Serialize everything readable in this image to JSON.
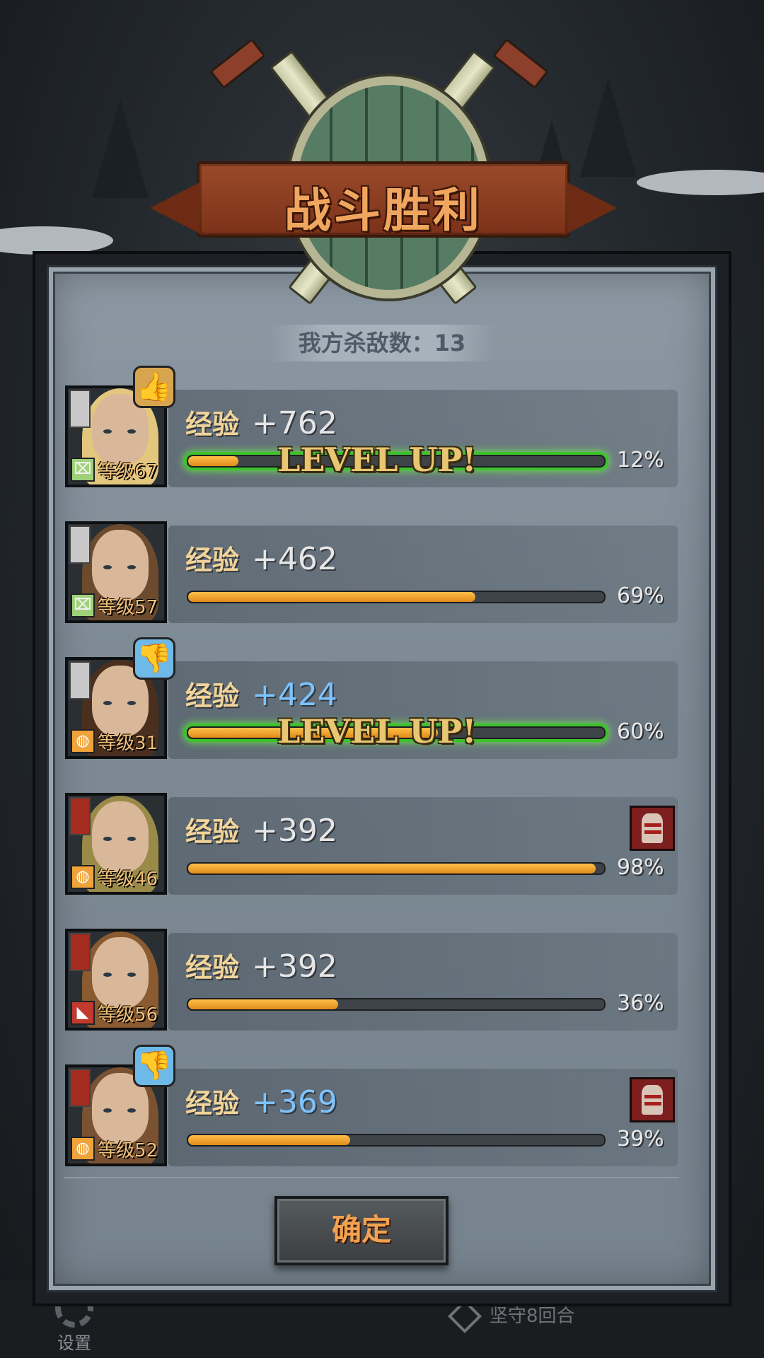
{
  "title": "战斗胜利",
  "kills_label": "我方杀敌数：13",
  "level_up_text": "LEVEL UP!",
  "exp_label": "经验",
  "confirm_label": "确定",
  "bottom": {
    "settings_label": "设置",
    "defend_label": "坚守8回合"
  },
  "heroes": [
    {
      "exp": "+762",
      "exp_highlight": false,
      "level": "等级67",
      "progress": "12%",
      "progress_value": 12,
      "level_up": true,
      "badge": "thumbs-up",
      "injured": false,
      "class": "green",
      "flag": "white"
    },
    {
      "exp": "+462",
      "exp_highlight": false,
      "level": "等级57",
      "progress": "69%",
      "progress_value": 69,
      "level_up": false,
      "badge": null,
      "injured": false,
      "class": "green",
      "flag": "white"
    },
    {
      "exp": "+424",
      "exp_highlight": true,
      "level": "等级31",
      "progress": "60%",
      "progress_value": 60,
      "level_up": true,
      "badge": "thumbs-down",
      "injured": false,
      "class": "orange",
      "flag": "white"
    },
    {
      "exp": "+392",
      "exp_highlight": false,
      "level": "等级46",
      "progress": "98%",
      "progress_value": 98,
      "level_up": false,
      "badge": null,
      "injured": true,
      "class": "orange",
      "flag": "red"
    },
    {
      "exp": "+392",
      "exp_highlight": false,
      "level": "等级56",
      "progress": "36%",
      "progress_value": 36,
      "level_up": false,
      "badge": null,
      "injured": false,
      "class": "red",
      "flag": "red"
    },
    {
      "exp": "+369",
      "exp_highlight": true,
      "level": "等级52",
      "progress": "39%",
      "progress_value": 39,
      "level_up": false,
      "badge": "thumbs-down",
      "injured": true,
      "class": "orange",
      "flag": "red"
    }
  ],
  "colors": {
    "banner": "#9a4a2a",
    "title_text": "#f0a65f",
    "bar_fill": "#f0a02a",
    "level_glow": "#3ec12b",
    "exp_blue": "#7ec3ff"
  }
}
